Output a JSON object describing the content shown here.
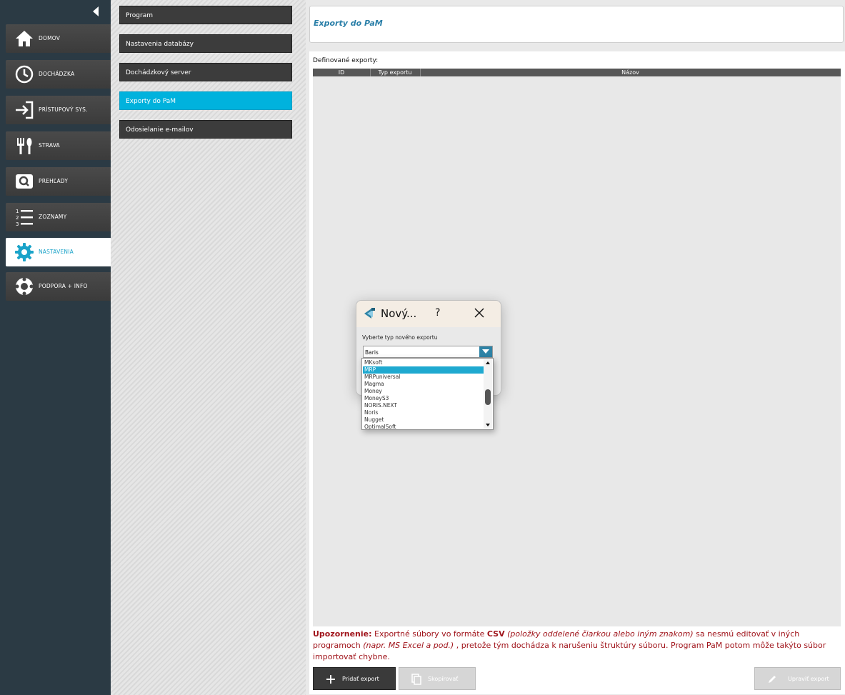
{
  "sidebar": {
    "items": [
      {
        "label": "DOMOV",
        "icon": "home-icon"
      },
      {
        "label": "DOCHÁDZKA",
        "icon": "clock-icon"
      },
      {
        "label": "PRÍSTUPOVÝ SYS.",
        "icon": "login-arrow-icon"
      },
      {
        "label": "STRAVA",
        "icon": "cutlery-icon"
      },
      {
        "label": "PREHĽADY",
        "icon": "search-icon"
      },
      {
        "label": "ZOZNAMY",
        "icon": "numbered-list-icon"
      },
      {
        "label": "NASTAVENIA",
        "icon": "gear-icon",
        "active": true
      },
      {
        "label": "PODPORA + INFO",
        "icon": "lifebuoy-icon"
      }
    ]
  },
  "settings_menu": {
    "items": [
      {
        "label": "Program"
      },
      {
        "label": "Nastavenia databázy"
      },
      {
        "label": "Dochádzkový server"
      },
      {
        "label": "Exporty do PaM",
        "active": true
      },
      {
        "label": "Odosielanie e-mailov"
      }
    ]
  },
  "header": {
    "title": "Exporty do PaM"
  },
  "content": {
    "defined_label": "Definované exporty:",
    "table": {
      "columns": [
        "ID",
        "Typ exportu",
        "Názov"
      ]
    }
  },
  "warning": {
    "bold": "Upozornenie:",
    "part1": " Exportné súbory vo formáte ",
    "csv": "CSV",
    "italic1": " (položky oddelené čiarkou alebo iným znakom)",
    "part2": " sa nesmú editovať v iných programoch ",
    "italic2": "(napr. MS Excel a pod.)",
    "part3": " , pretože tým dochádza k narušeniu štruktúry súboru. Program PaM potom môže takýto súbor importovať chybne."
  },
  "buttons": {
    "add": "Pridať export",
    "copy": "Skopírovať",
    "edit": "Upraviť export"
  },
  "dialog": {
    "title": "Nový...",
    "help": "?",
    "prompt": "Vyberte typ nového exportu",
    "selected_value": "Baris",
    "options": [
      "MKsoft",
      "MRP",
      "MRPuniversal",
      "Magma",
      "Money",
      "MoneyS3",
      "NORIS.NEXT",
      "Noris",
      "Nugget",
      "OptimalSoft"
    ],
    "highlighted_option": "MRP"
  },
  "colors": {
    "sidebar_bg": "#2b3a44",
    "accent": "#00b2dd",
    "warning": "#a0141b"
  }
}
